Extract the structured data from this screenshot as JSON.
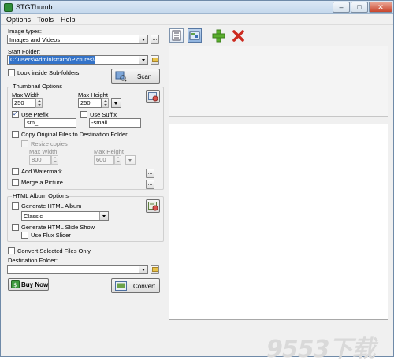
{
  "app": {
    "title": "STGThumb"
  },
  "window_controls": {
    "minimize": "–",
    "maximize": "□",
    "close": "✕"
  },
  "menu": [
    "Options",
    "Tools",
    "Help"
  ],
  "image_types": {
    "label": "Image types:",
    "value": "Images and Videos",
    "more": "..."
  },
  "start_folder": {
    "label": "Start Folder:",
    "value": "C:\\Users\\Administrator\\Pictures\\"
  },
  "look_inside": {
    "label": "Look inside Sub-folders",
    "checked": false
  },
  "scan_button": "Scan",
  "thumbnail": {
    "title": "Thumbnail Options",
    "max_width_label": "Max Width",
    "max_width": "250",
    "max_height_label": "Max Height",
    "max_height": "250",
    "use_prefix_label": "Use Prefix",
    "prefix": "sm_",
    "use_suffix_label": "Use Suffix",
    "suffix": "-small",
    "copy_original_label": "Copy Original Files to Destination Folder",
    "resize_copies_label": "Resize copies",
    "copy_max_width_label": "Max Width",
    "copy_max_width": "800",
    "copy_max_height_label": "Max Height",
    "copy_max_height": "600",
    "watermark_label": "Add Watermark",
    "merge_label": "Merge a Picture",
    "more": "..."
  },
  "html_album": {
    "title": "HTML Album Options",
    "generate_album_label": "Generate HTML Album",
    "template": "Classic",
    "slideshow_label": "Generate HTML Slide Show",
    "flux_label": "Use Flux Slider"
  },
  "convert_selected_label": "Convert Selected Files Only",
  "destination": {
    "label": "Destination Folder:",
    "value": ""
  },
  "buy_now": "Buy Now",
  "convert": "Convert",
  "watermark_text": "9553下载"
}
